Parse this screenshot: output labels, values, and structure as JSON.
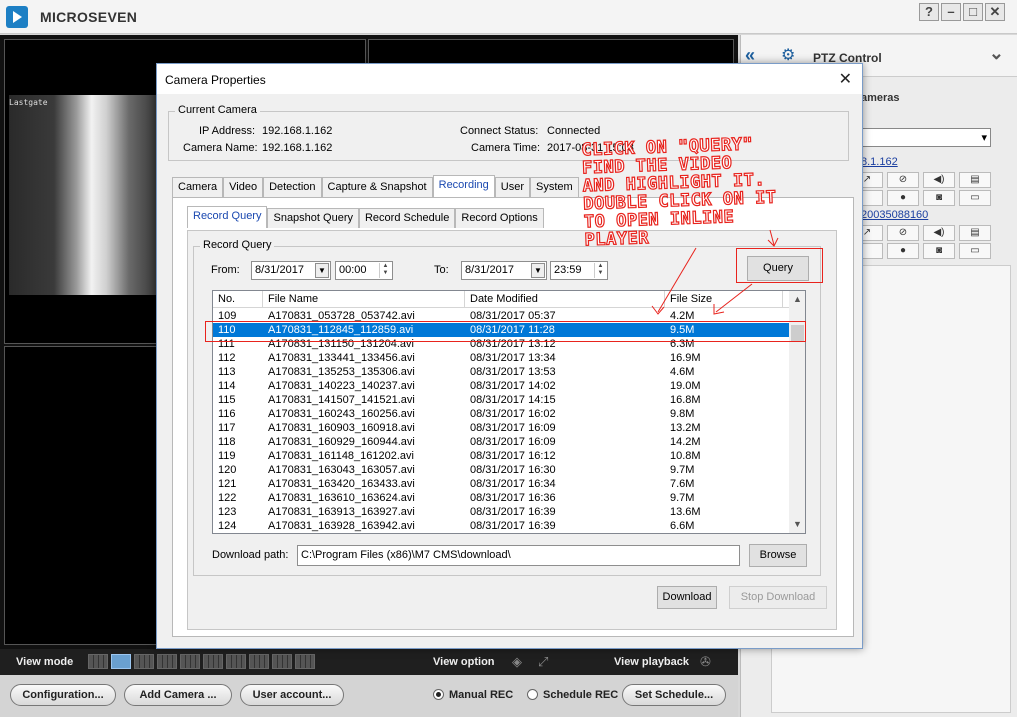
{
  "app": {
    "name": "MICROSEVEN",
    "window_buttons": [
      "?",
      "–",
      "□",
      "✕"
    ]
  },
  "video": {
    "pane_label": "Lastgate"
  },
  "right_panel": {
    "title": "PTZ Control",
    "cameras_label": "ameras",
    "link1": "8.1.162",
    "link2": "20035088160"
  },
  "bottom": {
    "view_mode": "View mode",
    "view_option": "View option",
    "view_playback": "View playback",
    "configuration": "Configuration...",
    "add_camera": "Add Camera ...",
    "user_account": "User account...",
    "manual_rec": "Manual REC",
    "schedule_rec": "Schedule REC",
    "set_schedule": "Set Schedule..."
  },
  "dialog": {
    "title": "Camera Properties",
    "current_camera": {
      "legend": "Current Camera",
      "ip_label": "IP Address:",
      "ip_value": "192.168.1.162",
      "name_label": "Camera Name:",
      "name_value": "192.168.1.162",
      "status_label": "Connect Status:",
      "status_value": "Connected",
      "time_label": "Camera Time:",
      "time_value": "2017-08-31 15:08"
    },
    "tabs": [
      "Camera",
      "Video",
      "Detection",
      "Capture & Snapshot",
      "Recording",
      "User",
      "System"
    ],
    "subtabs": [
      "Record Query",
      "Snapshot Query",
      "Record Schedule",
      "Record Options"
    ],
    "record_query": {
      "legend": "Record Query",
      "from_label": "From:",
      "from_date": "8/31/2017",
      "from_time": "00:00",
      "to_label": "To:",
      "to_date": "8/31/2017",
      "to_time": "23:59",
      "query_button": "Query",
      "columns": [
        "No.",
        "File Name",
        "Date Modified",
        "File Size"
      ],
      "rows": [
        [
          "109",
          "A170831_053728_053742.avi",
          "08/31/2017 05:37",
          "4.2M"
        ],
        [
          "110",
          "A170831_112845_112859.avi",
          "08/31/2017 11:28",
          "9.5M"
        ],
        [
          "111",
          "A170831_131150_131204.avi",
          "08/31/2017 13:12",
          "6.3M"
        ],
        [
          "112",
          "A170831_133441_133456.avi",
          "08/31/2017 13:34",
          "16.9M"
        ],
        [
          "113",
          "A170831_135253_135306.avi",
          "08/31/2017 13:53",
          "4.6M"
        ],
        [
          "114",
          "A170831_140223_140237.avi",
          "08/31/2017 14:02",
          "19.0M"
        ],
        [
          "115",
          "A170831_141507_141521.avi",
          "08/31/2017 14:15",
          "16.8M"
        ],
        [
          "116",
          "A170831_160243_160256.avi",
          "08/31/2017 16:02",
          "9.8M"
        ],
        [
          "117",
          "A170831_160903_160918.avi",
          "08/31/2017 16:09",
          "13.2M"
        ],
        [
          "118",
          "A170831_160929_160944.avi",
          "08/31/2017 16:09",
          "14.2M"
        ],
        [
          "119",
          "A170831_161148_161202.avi",
          "08/31/2017 16:12",
          "10.8M"
        ],
        [
          "120",
          "A170831_163043_163057.avi",
          "08/31/2017 16:30",
          "9.7M"
        ],
        [
          "121",
          "A170831_163420_163433.avi",
          "08/31/2017 16:34",
          "7.6M"
        ],
        [
          "122",
          "A170831_163610_163624.avi",
          "08/31/2017 16:36",
          "9.7M"
        ],
        [
          "123",
          "A170831_163913_163927.avi",
          "08/31/2017 16:39",
          "13.6M"
        ],
        [
          "124",
          "A170831_163928_163942.avi",
          "08/31/2017 16:39",
          "6.6M"
        ]
      ],
      "selected_index": 1,
      "download_path_label": "Download path:",
      "download_path": "C:\\Program Files (x86)\\M7 CMS\\download\\",
      "browse_button": "Browse"
    },
    "download_button": "Download",
    "stop_download_button": "Stop Download"
  },
  "annotation": {
    "text": "CLICK ON \"QUERY\"\nFIND THE VIDEO\nAND HIGHLIGHT IT.\nDOUBLE CLICK ON IT\nTO OPEN INLINE\nPLAYER",
    "color": "#e8231d"
  }
}
